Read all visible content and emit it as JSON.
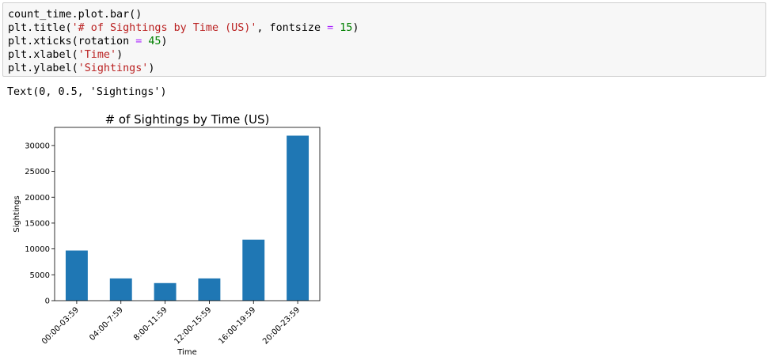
{
  "notebook": {
    "code_lines": [
      [
        {
          "t": "count_time.plot.bar()",
          "c": ""
        }
      ],
      [
        {
          "t": "plt.title(",
          "c": ""
        },
        {
          "t": "'# of Sightings by Time (US)'",
          "c": "str"
        },
        {
          "t": ", fontsize ",
          "c": ""
        },
        {
          "t": "=",
          "c": "op"
        },
        {
          "t": " ",
          "c": ""
        },
        {
          "t": "15",
          "c": "num"
        },
        {
          "t": ")",
          "c": ""
        }
      ],
      [
        {
          "t": "plt.xticks(rotation ",
          "c": ""
        },
        {
          "t": "=",
          "c": "op"
        },
        {
          "t": " ",
          "c": ""
        },
        {
          "t": "45",
          "c": "num"
        },
        {
          "t": ")",
          "c": ""
        }
      ],
      [
        {
          "t": "plt.xlabel(",
          "c": ""
        },
        {
          "t": "'Time'",
          "c": "str"
        },
        {
          "t": ")",
          "c": ""
        }
      ],
      [
        {
          "t": "plt.ylabel(",
          "c": ""
        },
        {
          "t": "'Sightings'",
          "c": "str"
        },
        {
          "t": ")",
          "c": ""
        }
      ]
    ],
    "output_text": "Text(0, 0.5, 'Sightings')"
  },
  "colors": {
    "bar": "#1f77b4",
    "string": "#ba2121",
    "operator": "#aa22ff",
    "number": "#008000"
  },
  "chart_data": {
    "type": "bar",
    "title": "# of Sightings by Time (US)",
    "xlabel": "Time",
    "ylabel": "Sightings",
    "categories": [
      "00:00-03:59",
      "04:00-7:59",
      "8:00-11:59",
      "12:00-15:59",
      "16:00-19:59",
      "20:00-23:59"
    ],
    "values": [
      9700,
      4300,
      3400,
      4300,
      11800,
      31900
    ],
    "yticks": [
      0,
      5000,
      10000,
      15000,
      20000,
      25000,
      30000
    ],
    "ylim": [
      0,
      33500
    ],
    "grid": false,
    "legend": "none"
  }
}
